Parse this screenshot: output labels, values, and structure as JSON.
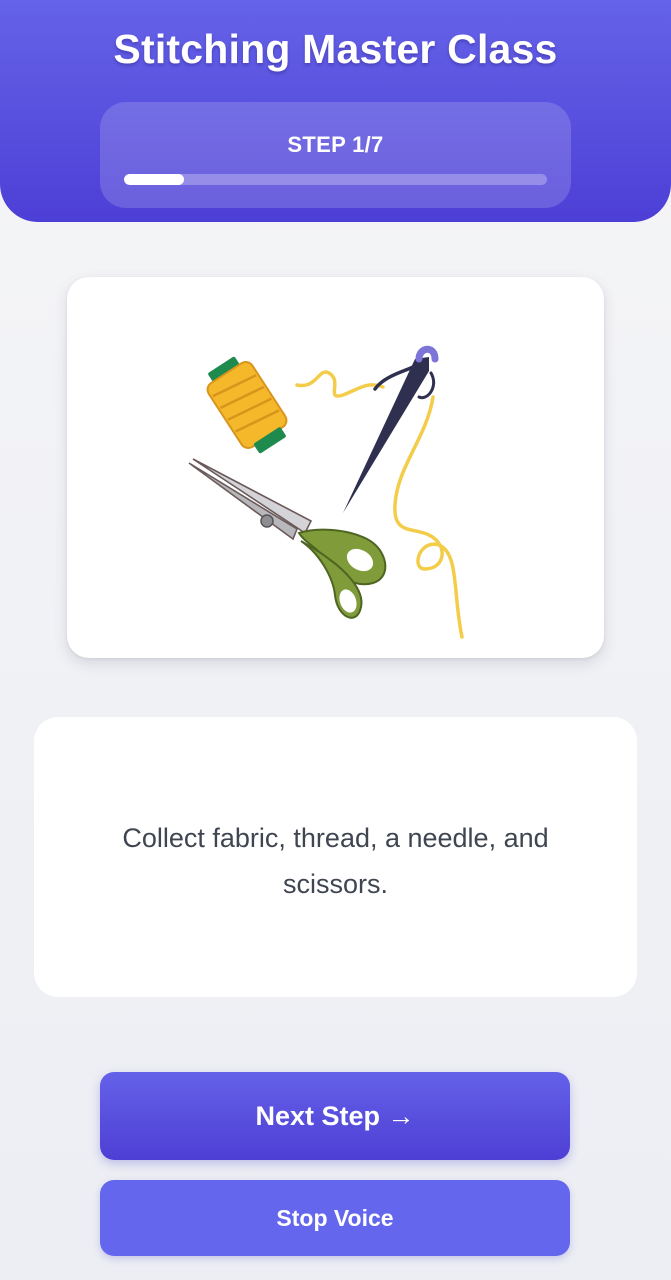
{
  "header": {
    "title": "Stitching Master Class",
    "step_label": "STEP 1/7",
    "progress": {
      "current": 1,
      "total": 7,
      "fraction": 0.143
    }
  },
  "illustration": {
    "name": "sewing-supplies-illustration",
    "items": [
      "thread-spool-icon",
      "needle-icon",
      "scissors-icon"
    ]
  },
  "instruction": {
    "text": "Collect fabric, thread, a needle, and scissors."
  },
  "buttons": {
    "next_label": "Next Step →",
    "stop_voice_label": "Stop Voice"
  },
  "colors": {
    "accent": "#5a52e0",
    "accent_dark": "#4d3fd6",
    "stop_button": "#6466ee",
    "spool": "#f4b82a",
    "spool_caps": "#1e8a4e",
    "thread": "#f3cd4a",
    "needle": "#2f3050",
    "scissor_handle": "#7f9b3a"
  }
}
